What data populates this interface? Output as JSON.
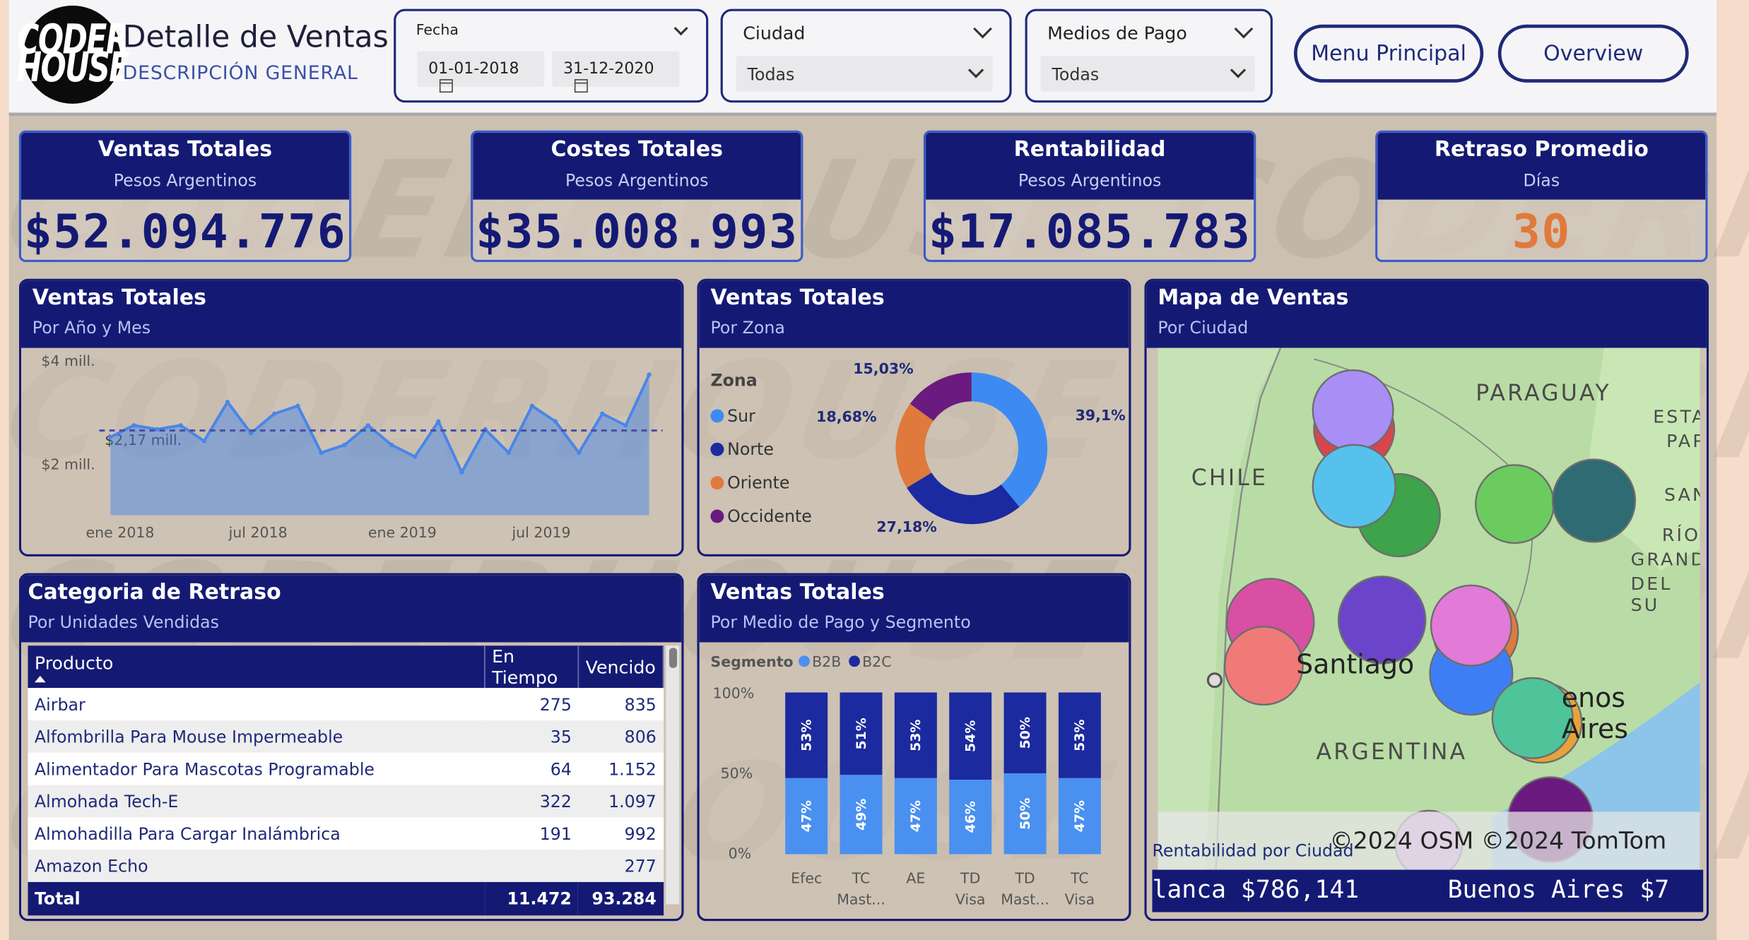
{
  "header": {
    "logo_line1": "CODER",
    "logo_line2": "HOUSE",
    "title": "Detalle de Ventas",
    "subtitle": "DESCRIPCIÓN GENERAL"
  },
  "filters": {
    "fecha": {
      "label": "Fecha",
      "from": "01-01-2018",
      "to": "31-12-2020"
    },
    "ciudad": {
      "label": "Ciudad",
      "value": "Todas"
    },
    "medios": {
      "label": "Medios de Pago",
      "value": "Todas"
    }
  },
  "nav": {
    "menu_principal": "Menu Principal",
    "overview": "Overview"
  },
  "kpis": [
    {
      "title": "Ventas Totales",
      "subtitle": "Pesos Argentinos",
      "value": "$52.094.776",
      "color": "#141a74"
    },
    {
      "title": "Costes Totales",
      "subtitle": "Pesos Argentinos",
      "value": "$35.008.993",
      "color": "#141a74"
    },
    {
      "title": "Rentabilidad",
      "subtitle": "Pesos Argentinos",
      "value": "$17.085.783",
      "color": "#141a74"
    },
    {
      "title": "Retraso Promedio",
      "subtitle": "Días",
      "value": "30",
      "color": "#e07a3c"
    }
  ],
  "line_panel": {
    "title": "Ventas Totales",
    "subtitle": "Por Año y Mes",
    "y_labels": [
      "$4 mill.",
      "$2 mill."
    ],
    "avg_label": "$2,17 mill.",
    "x_labels": [
      "ene 2018",
      "jul 2018",
      "ene 2019",
      "jul 2019"
    ]
  },
  "donut_panel": {
    "title": "Ventas Totales",
    "subtitle": "Por Zona",
    "legend_title": "Zona"
  },
  "bar_panel": {
    "title": "Ventas Totales",
    "subtitle": "Por Medio de Pago y Segmento",
    "legend_title": "Segmento",
    "y_labels": [
      "100%",
      "50%",
      "0%"
    ]
  },
  "map_panel": {
    "title": "Mapa de Ventas",
    "subtitle": "Por Ciudad",
    "labels": {
      "paraguay": "PARAGUAY",
      "chile": "CHILE",
      "argentina": "ARGENTINA",
      "santiago": "Santiago",
      "buenos_aires": "enos Aires",
      "esta": "ESTA",
      "par": "PAR",
      "san": "SAN",
      "rio": "RÍO",
      "grand": "GRAND",
      "delsu": "DEL SU"
    },
    "attribution": "©2024 OSM  ©2024 TomTom",
    "ticker_title": "Rentabilidad por Ciudad",
    "ticker": "lanca $786,141      Buenos Aires $7"
  },
  "table_panel": {
    "title": "Categoria de Retraso",
    "subtitle": "Por Unidades Vendidas",
    "columns": [
      "Producto",
      "En Tiempo",
      "Vencido"
    ],
    "rows": [
      [
        "Airbar",
        "275",
        "835"
      ],
      [
        "Alfombrilla Para Mouse Impermeable",
        "35",
        "806"
      ],
      [
        "Alimentador Para Mascotas Programable",
        "64",
        "1.152"
      ],
      [
        "Almohada Tech-E",
        "322",
        "1.097"
      ],
      [
        "Almohadilla Para Cargar Inalámbrica",
        "191",
        "992"
      ],
      [
        "Amazon Echo",
        "",
        "277"
      ]
    ],
    "total": [
      "Total",
      "11.472",
      "93.284"
    ]
  },
  "chart_data": [
    {
      "type": "area",
      "title": "Ventas Totales",
      "subtitle": "Por Año y Mes",
      "xlabel": "",
      "ylabel": "",
      "x_ticks": [
        "ene 2018",
        "jul 2018",
        "ene 2019",
        "jul 2019"
      ],
      "values_mill": [
        2.0,
        2.3,
        2.2,
        2.3,
        1.9,
        2.9,
        2.1,
        2.6,
        2.8,
        1.6,
        1.8,
        2.3,
        1.8,
        1.5,
        2.4,
        1.1,
        2.2,
        1.6,
        2.8,
        2.4,
        1.6,
        2.6,
        2.3,
        3.6
      ],
      "average_mill": 2.17,
      "ylim": [
        0,
        4
      ],
      "color": "#4a86e8"
    },
    {
      "type": "pie",
      "title": "Ventas Totales",
      "subtitle": "Por Zona",
      "legend_title": "Zona",
      "categories": [
        "Sur",
        "Norte",
        "Oriente",
        "Occidente"
      ],
      "values": [
        39.1,
        27.18,
        18.68,
        15.03
      ],
      "labels": [
        "39,1%",
        "27,18%",
        "18,68%",
        "15,03%"
      ],
      "colors": [
        "#3d8bf2",
        "#1b2aa0",
        "#e07a3c",
        "#6b1a7f"
      ]
    },
    {
      "type": "bar",
      "stacked_percent": true,
      "title": "Ventas Totales",
      "subtitle": "Por Medio de Pago y Segmento",
      "legend_title": "Segmento",
      "categories": [
        "Efec",
        "TC Mast...",
        "AE",
        "TD Visa",
        "TD Mast...",
        "TC Visa"
      ],
      "category_lines": [
        [
          "Efec"
        ],
        [
          "TC",
          "Mast..."
        ],
        [
          "AE"
        ],
        [
          "TD",
          "Visa"
        ],
        [
          "TD",
          "Mast..."
        ],
        [
          "TC",
          "Visa"
        ]
      ],
      "series": [
        {
          "name": "B2B",
          "values": [
            47,
            49,
            47,
            46,
            50,
            47
          ],
          "labels": [
            "47%",
            "49%",
            "47%",
            "46%",
            "50%",
            "47%"
          ],
          "color": "#4a90f0"
        },
        {
          "name": "B2C",
          "values": [
            53,
            51,
            53,
            54,
            50,
            53
          ],
          "labels": [
            "53%",
            "51%",
            "53%",
            "54%",
            "50%",
            "53%"
          ],
          "color": "#1b2a9e"
        }
      ],
      "ylim": [
        0,
        100
      ]
    }
  ],
  "map_bubbles": [
    {
      "color": "#d9454d"
    },
    {
      "color": "#a98ef5"
    },
    {
      "color": "#3ea34a"
    },
    {
      "color": "#56c1ec"
    },
    {
      "color": "#6ccb5f"
    },
    {
      "color": "#2f6b73"
    },
    {
      "color": "#d94fa4"
    },
    {
      "color": "#f07a78"
    },
    {
      "color": "#6b45c9"
    },
    {
      "color": "#e07a3c"
    },
    {
      "color": "#3d7ef5"
    },
    {
      "color": "#e5a33a"
    },
    {
      "color": "#e27ad8"
    },
    {
      "color": "#4fc39a"
    },
    {
      "color": "#6b1a7f"
    },
    {
      "color": "#c8a0e0"
    }
  ]
}
